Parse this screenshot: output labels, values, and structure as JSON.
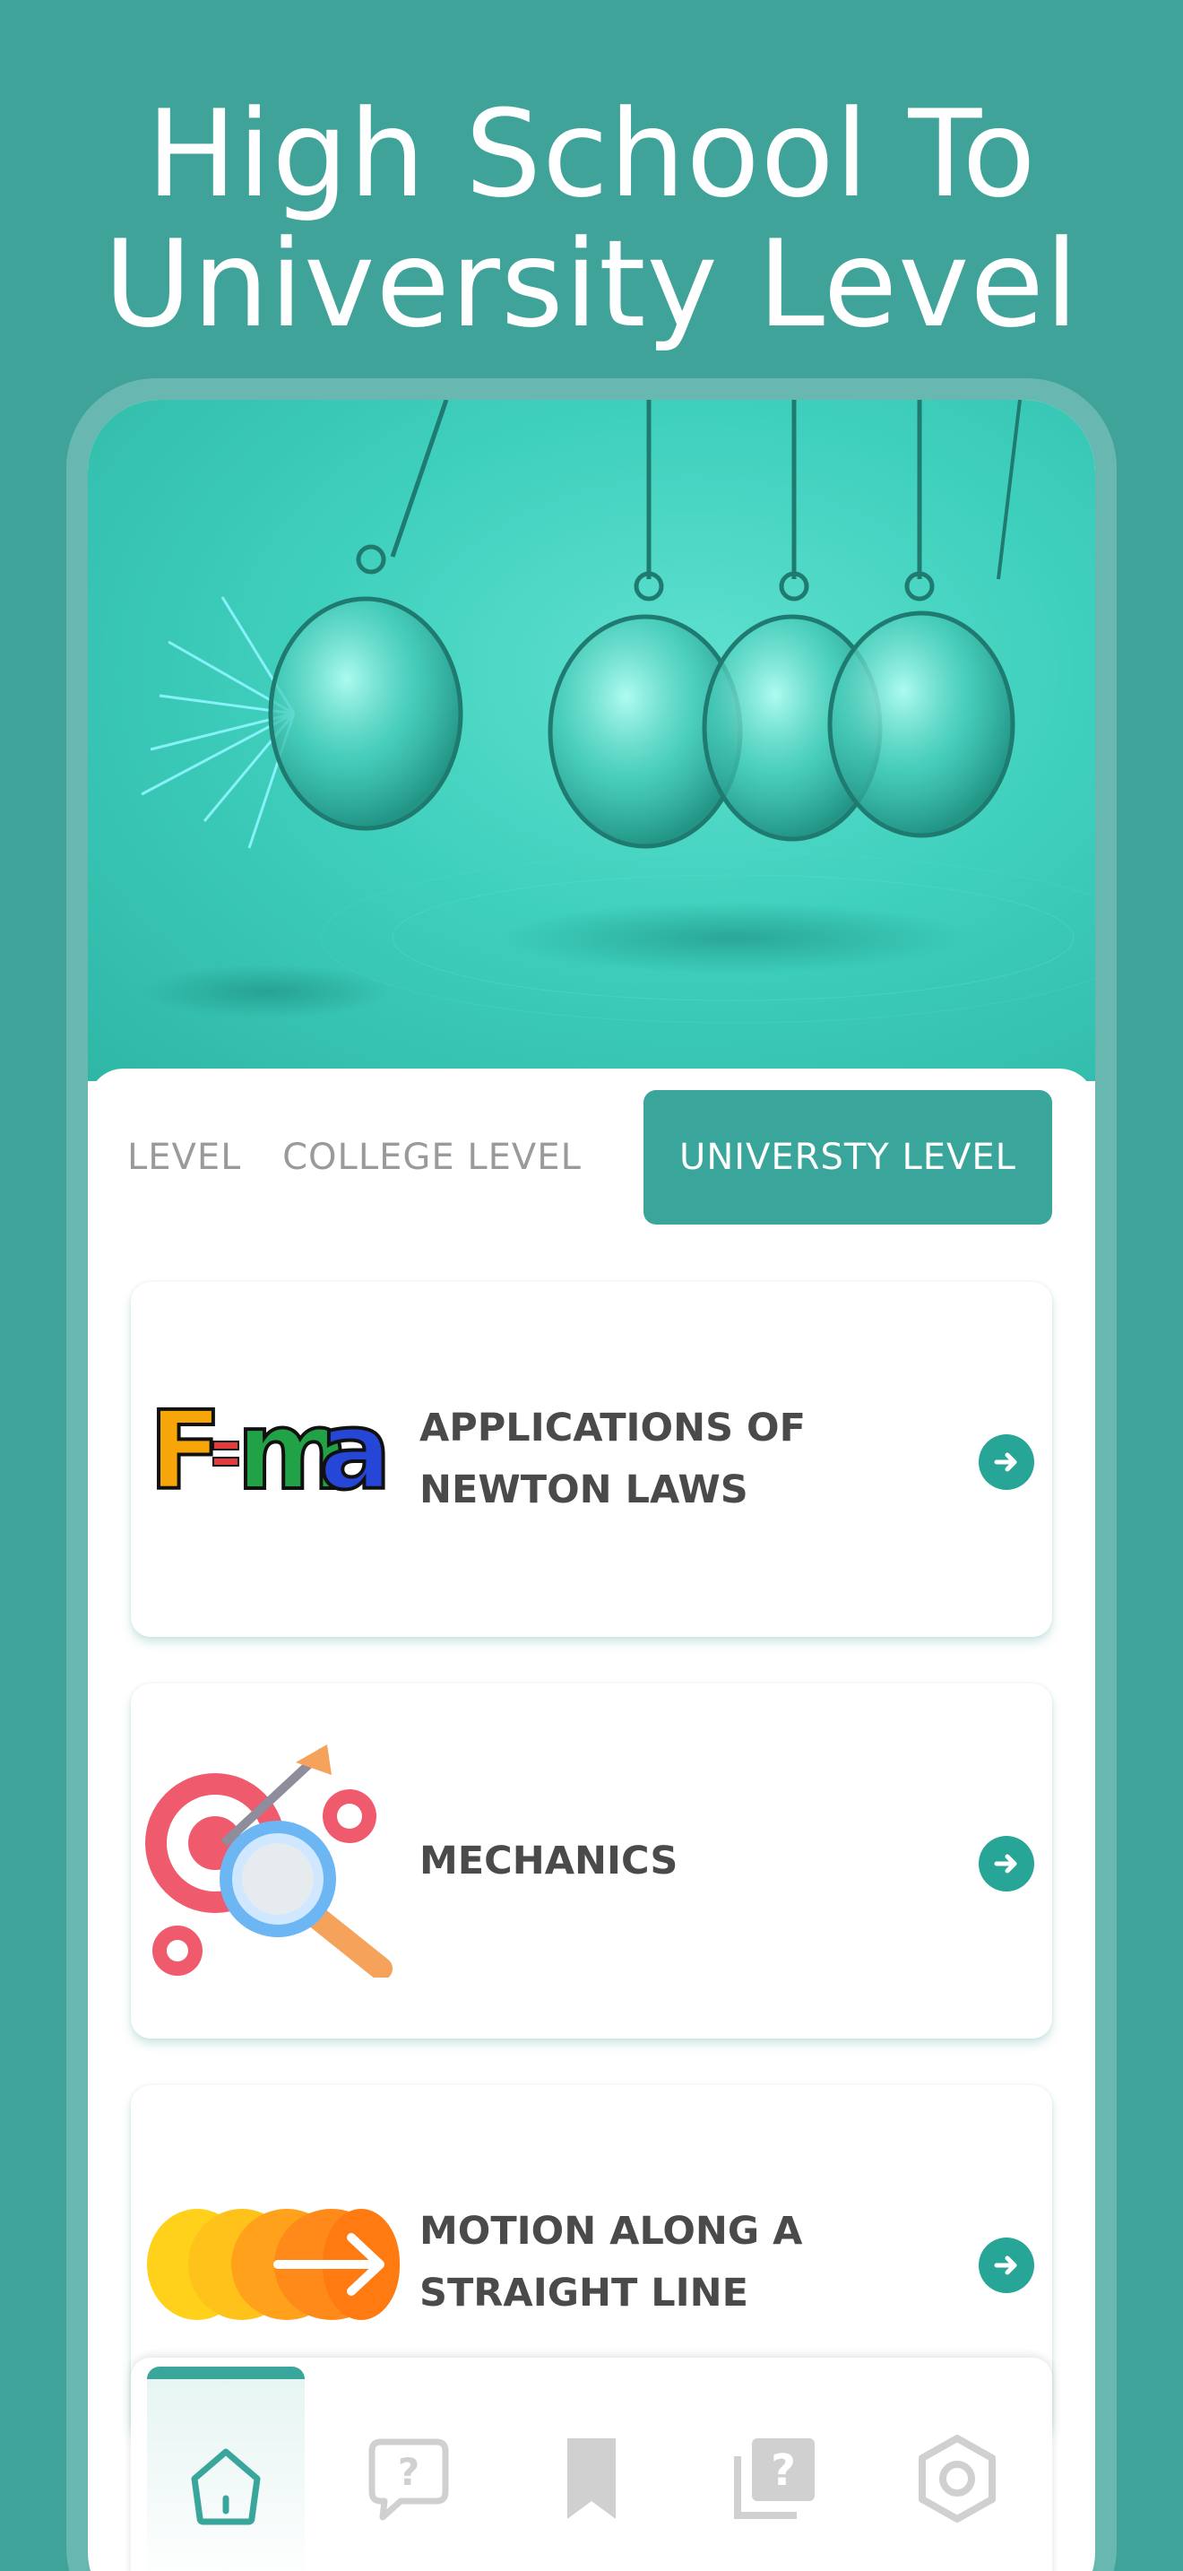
{
  "headline": {
    "line1": "High School To",
    "line2": "University Level"
  },
  "tabs": [
    {
      "label": "LEVEL",
      "active": false
    },
    {
      "label": "COLLEGE LEVEL",
      "active": false
    },
    {
      "label": "UNIVERSTY LEVEL",
      "active": true
    }
  ],
  "topics": [
    {
      "title": "APPLICATIONS OF NEWTON LAWS",
      "icon": "fma-formula-icon"
    },
    {
      "title": "MECHANICS",
      "icon": "target-magnifier-icon"
    },
    {
      "title": "MOTION ALONG A STRAIGHT LINE",
      "icon": "motion-arrow-icon"
    }
  ],
  "bottom_nav": [
    {
      "name": "home-icon",
      "active": true
    },
    {
      "name": "question-chat-icon",
      "active": false
    },
    {
      "name": "bookmark-icon",
      "active": false
    },
    {
      "name": "quiz-icon",
      "active": false
    },
    {
      "name": "settings-icon",
      "active": false
    }
  ],
  "colors": {
    "background": "#3fa39a",
    "accent": "#3aa69b",
    "arrow": "#27a596",
    "text": "#4a4a4a",
    "muted": "#9a9a9a"
  }
}
